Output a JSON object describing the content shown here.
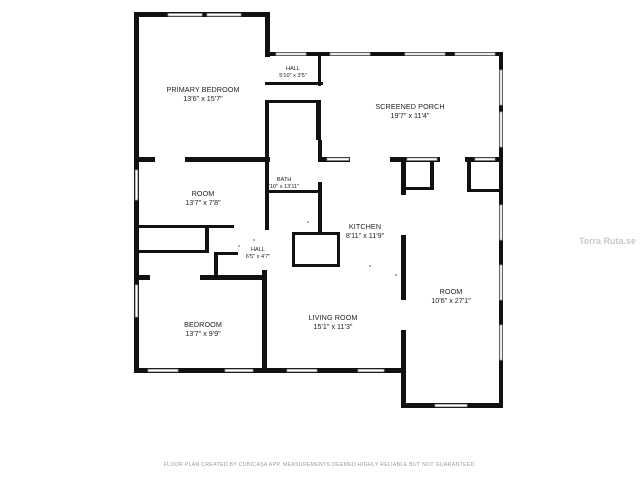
{
  "rooms": {
    "primary_bedroom": {
      "name": "PRIMARY BEDROOM",
      "dim": "13'6\" x 15'7\""
    },
    "hall_top": {
      "name": "HALL",
      "dim": "5'10\" x 3'5\""
    },
    "screened_porch": {
      "name": "SCREENED PORCH",
      "dim": "19'7\" x 11'4\""
    },
    "bath": {
      "name": "BATH",
      "dim": "'10\" x 13'11\""
    },
    "room_small": {
      "name": "ROOM",
      "dim": "13'7\" x 7'8\""
    },
    "kitchen": {
      "name": "KITCHEN",
      "dim": "8'11\" x 11'9\""
    },
    "hall_mid": {
      "name": "HALL",
      "dim": "6'5\" x 4'7\""
    },
    "room_large": {
      "name": "ROOM",
      "dim": "10'6\" x 27'1\""
    },
    "bedroom": {
      "name": "BEDROOM",
      "dim": "13'7\" x 9'9\""
    },
    "living_room": {
      "name": "LIVING ROOM",
      "dim": "15'1\" x 11'3\""
    }
  },
  "footer": "FLOOR PLAN CREATED BY CUBICASA APP. MEASUREMENTS DEEMED HIGHLY RELIABLE BUT NOT GUARANTEED.",
  "watermark": "Terra Ruta.se"
}
